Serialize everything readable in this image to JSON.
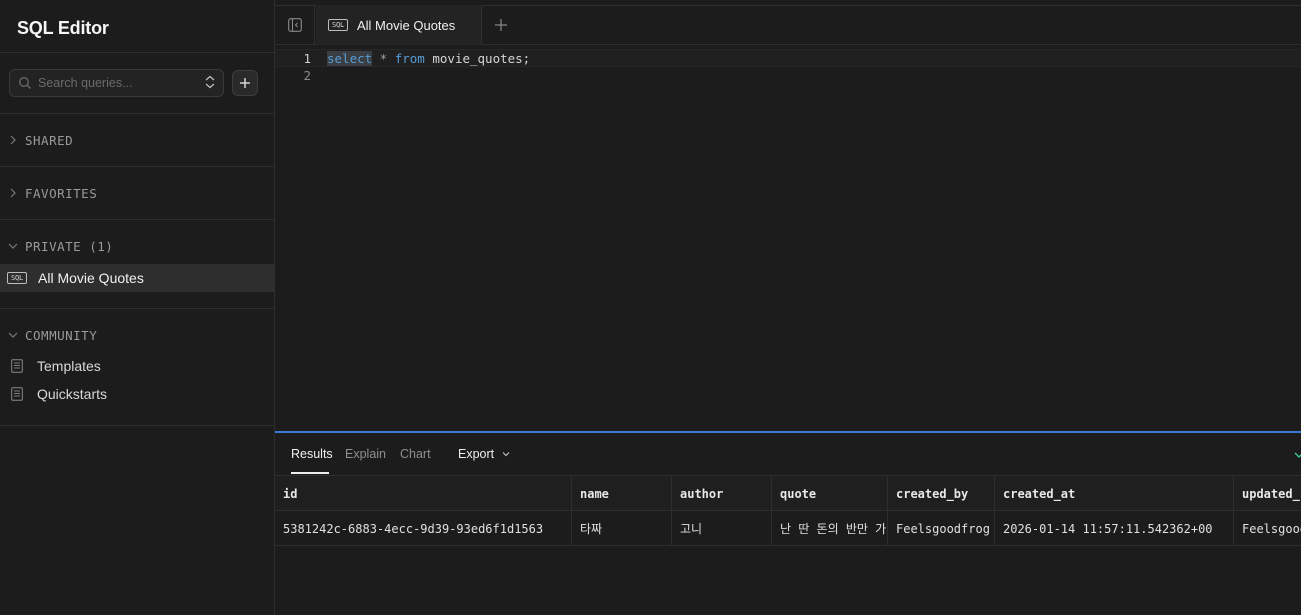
{
  "sidebar": {
    "title": "SQL Editor",
    "search": {
      "placeholder": "Search queries..."
    },
    "sections": {
      "shared": "SHARED",
      "favorites": "FAVORITES",
      "private": "PRIVATE (1)",
      "community": "COMMUNITY"
    },
    "private_items": [
      {
        "badge": "SQL",
        "label": "All Movie Quotes"
      }
    ],
    "community_items": [
      {
        "label": "Templates"
      },
      {
        "label": "Quickstarts"
      }
    ]
  },
  "tabs": [
    {
      "badge": "SQL",
      "label": "All Movie Quotes"
    }
  ],
  "editor": {
    "line_numbers": [
      "1",
      "2"
    ],
    "line1": {
      "kw1": "select",
      "star": " * ",
      "kw2": "from",
      "rest": " movie_quotes;"
    }
  },
  "results": {
    "tabs": [
      "Results",
      "Explain",
      "Chart"
    ],
    "export_label": "Export",
    "columns": [
      "id",
      "name",
      "author",
      "quote",
      "created_by",
      "created_at",
      "updated_"
    ],
    "rows": [
      [
        "5381242c-6883-4ecc-9d39-93ed6f1d1563",
        "타짜",
        "고니",
        "난 딴 돈의 반만 가",
        "Feelsgoodfrog",
        "2026-01-14 11:57:11.542362+00",
        "Feelsgoodfrog"
      ]
    ]
  },
  "colors": {
    "background": "#1c1c1c",
    "keyword": "#569cd6",
    "resize_accent": "#3a7bd5",
    "active_row": "#2e2e2e"
  },
  "icons": [
    "search-icon",
    "sort-icon",
    "plus-icon",
    "chevron-right-icon",
    "chevron-down-icon",
    "sql-file-icon",
    "document-icon",
    "sidebar-collapse-icon"
  ]
}
